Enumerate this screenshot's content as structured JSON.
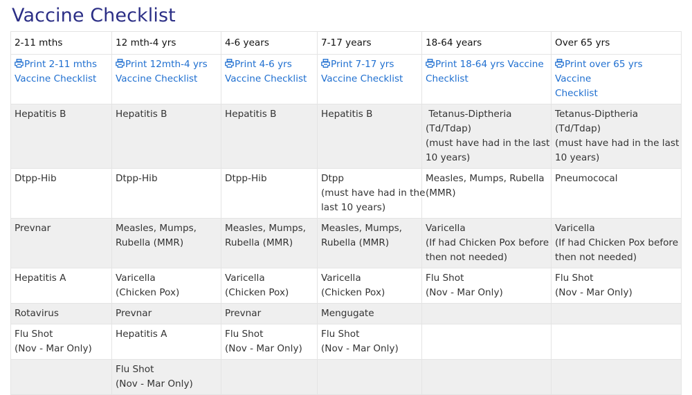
{
  "title": "Vaccine Checklist",
  "columns": [
    "2-11 mths",
    "12 mth-4 yrs",
    "4-6 years",
    "7-17 years",
    "18-64 years",
    "Over 65 yrs"
  ],
  "print_links": [
    [
      "Print 2-11 mths",
      "Vaccine Checklist"
    ],
    [
      "Print 12mth-4 yrs",
      "Vaccine Checklist"
    ],
    [
      "Print 4-6 yrs",
      "Vaccine Checklist"
    ],
    [
      "Print 7-17 yrs",
      "Vaccine Checklist"
    ],
    [
      "Print 18-64 yrs Vaccine",
      "Checklist"
    ],
    [
      "Print over 65 yrs Vaccine",
      "Checklist"
    ]
  ],
  "print_icon": "printer-icon",
  "colors": {
    "title": "#2c2f86",
    "link": "#1f6fd0",
    "shade": "#efefef",
    "border": "#e4e4e4"
  },
  "rows": [
    [
      [
        "Hepatitis B"
      ],
      [
        "Hepatitis B"
      ],
      [
        "Hepatitis B"
      ],
      [
        "Hepatitis B"
      ],
      [
        " Tetanus-Diptheria",
        "(Td/Tdap)",
        "(must have had in the last",
        "10 years)"
      ],
      [
        "Tetanus-Diptheria",
        "(Td/Tdap)",
        "(must have had in the last",
        "10 years)"
      ]
    ],
    [
      [
        "Dtpp-Hib"
      ],
      [
        "Dtpp-Hib"
      ],
      [
        "Dtpp-Hib"
      ],
      [
        "Dtpp",
        "(must have had in the",
        "last 10 years)"
      ],
      [
        "Measles, Mumps, Rubella",
        "(MMR)"
      ],
      [
        "Pneumococal"
      ]
    ],
    [
      [
        "Prevnar"
      ],
      [
        "Measles, Mumps,",
        "Rubella (MMR)"
      ],
      [
        "Measles, Mumps,",
        "Rubella (MMR)"
      ],
      [
        "Measles, Mumps,",
        "Rubella (MMR)"
      ],
      [
        "Varicella",
        "(If had Chicken Pox before",
        "then not needed)"
      ],
      [
        "Varicella",
        "(If had Chicken Pox before",
        "then not needed)"
      ]
    ],
    [
      [
        "Hepatitis A"
      ],
      [
        "Varicella",
        "(Chicken Pox)"
      ],
      [
        "Varicella",
        "(Chicken Pox)"
      ],
      [
        "Varicella",
        "(Chicken Pox)"
      ],
      [
        "Flu Shot",
        "(Nov - Mar Only)"
      ],
      [
        "Flu Shot",
        "(Nov - Mar Only)"
      ]
    ],
    [
      [
        "Rotavirus"
      ],
      [
        "Prevnar"
      ],
      [
        "Prevnar"
      ],
      [
        "Mengugate"
      ],
      [],
      []
    ],
    [
      [
        "Flu Shot",
        "(Nov - Mar Only)"
      ],
      [
        "Hepatitis A"
      ],
      [
        "Flu Shot",
        "(Nov - Mar Only)"
      ],
      [
        "Flu Shot",
        "(Nov - Mar Only)"
      ],
      [],
      []
    ],
    [
      [],
      [
        "Flu Shot",
        "(Nov - Mar Only)"
      ],
      [],
      [],
      [],
      []
    ]
  ]
}
